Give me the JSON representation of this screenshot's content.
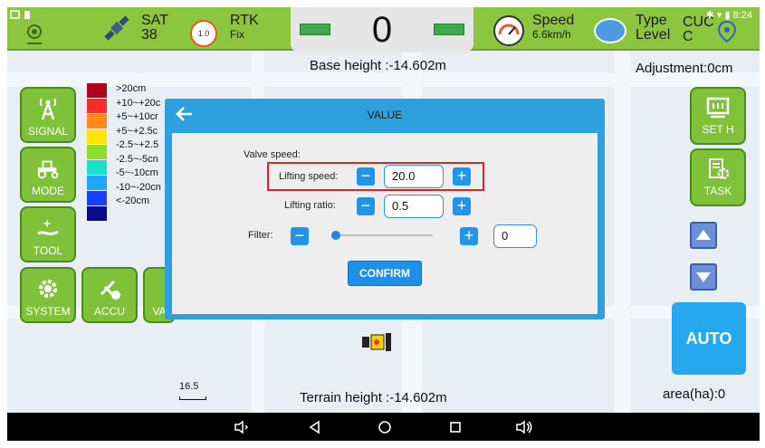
{
  "status_bar": {
    "time": "8:24"
  },
  "topbar": {
    "sat_label": "SAT",
    "sat_value": "38",
    "rtk_label": "RTK",
    "rtk_value": "Fix",
    "rtk_badge": "1.0",
    "center_value": "0",
    "speed_label": "Speed",
    "speed_value": "6.6km/h",
    "type_label": "Type",
    "type_value": "CUC",
    "level_label": "Level",
    "level_value": "C"
  },
  "readouts": {
    "base_height": "Base height :-14.602m",
    "adjustment": "Adjustment:0cm",
    "terrain_height": "Terrain height :-14.602m",
    "area": "area(ha):0",
    "scale": "16.5"
  },
  "legend": [
    {
      "label": ">20cm",
      "color": "#b3001b"
    },
    {
      "label": "+10~+20c",
      "color": "#ff2a2a"
    },
    {
      "label": "+5~+10cr",
      "color": "#ff8a1a"
    },
    {
      "label": "+5~+2.5c",
      "color": "#ffe600"
    },
    {
      "label": "-2.5~+2.5",
      "color": "#8fdc2a"
    },
    {
      "label": "-2.5~-5cn",
      "color": "#19e0c8"
    },
    {
      "label": "-5~-10cm",
      "color": "#1fa7ff"
    },
    {
      "label": "-10~-20cn",
      "color": "#1a3fff"
    },
    {
      "label": "<-20cm",
      "color": "#0a0a8c"
    }
  ],
  "left_buttons": {
    "signal": "SIGNAL",
    "mode": "MODE",
    "tool": "TOOL",
    "system": "SYSTEM",
    "accu": "ACCU",
    "va": "VA"
  },
  "right_buttons": {
    "set_h": "SET H",
    "task": "TASK",
    "auto": "AUTO"
  },
  "dialog": {
    "title": "VALUE",
    "section": "Valve speed:",
    "lifting_speed_label": "Lifting speed:",
    "lifting_speed_value": "20.0",
    "lifting_ratio_label": "Lifting ratio:",
    "lifting_ratio_value": "0.5",
    "filter_label": "Filter:",
    "filter_value": "0",
    "filter_level": 0,
    "confirm": "CONFIRM"
  },
  "colors": {
    "topbar": "#8cc63e",
    "accent_blue": "#2ea0dd",
    "highlight": "#e02424"
  }
}
